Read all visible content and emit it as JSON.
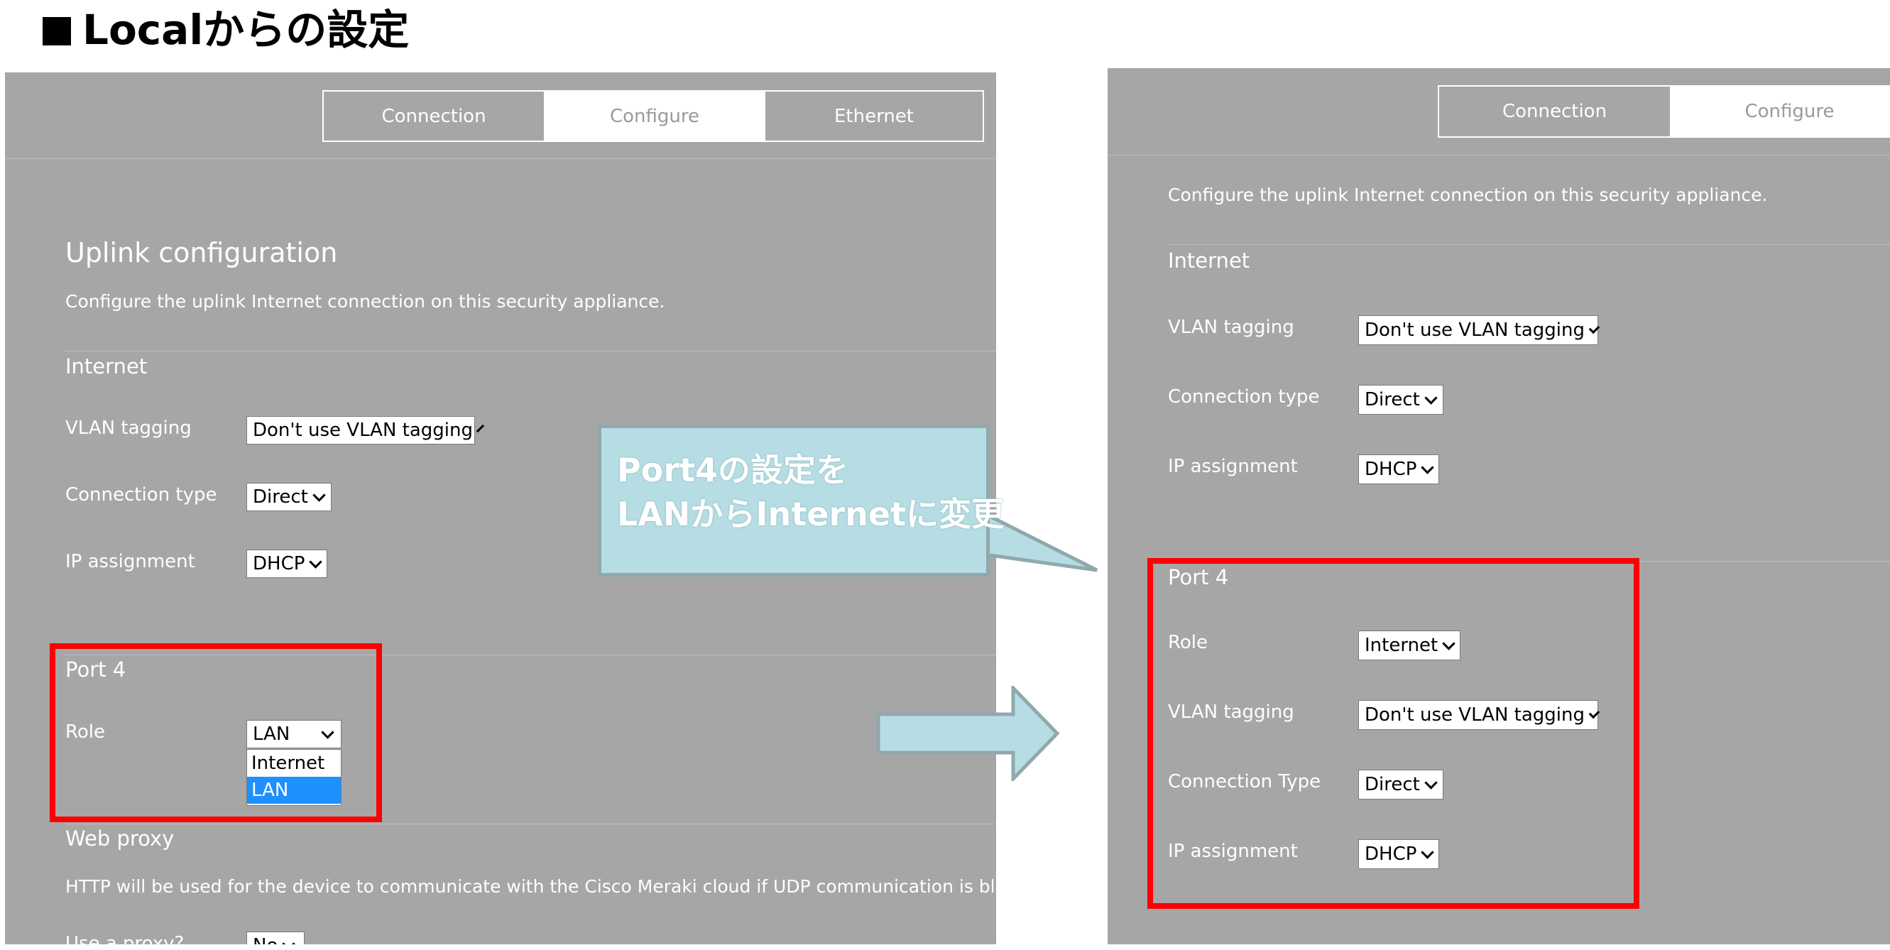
{
  "heading": "Localからの設定",
  "left": {
    "tabs": [
      {
        "label": "Connection",
        "active": false
      },
      {
        "label": "Configure",
        "active": true
      },
      {
        "label": "Ethernet",
        "active": false
      }
    ],
    "uplink_title": "Uplink configuration",
    "uplink_desc": "Configure the uplink Internet connection on this security appliance.",
    "internet_title": "Internet",
    "vlan_label": "VLAN tagging",
    "vlan_value": "Don't use VLAN tagging",
    "conn_label": "Connection type",
    "conn_value": "Direct",
    "ip_label": "IP assignment",
    "ip_value": "DHCP",
    "port_title": "Port 4",
    "role_label": "Role",
    "role_value": "LAN",
    "role_options": [
      "Internet",
      "LAN"
    ],
    "proxy_title": "Web proxy",
    "proxy_desc": "HTTP will be used for the device to communicate with the Cisco Meraki cloud if UDP communication is blocked",
    "proxy_label": "Use a proxy?",
    "proxy_value": "No"
  },
  "callout": {
    "line1": "Port4の設定を",
    "line2": "LANからInternetに変更"
  },
  "right": {
    "tabs": [
      {
        "label": "Connection",
        "active": false
      },
      {
        "label": "Configure",
        "active": true
      }
    ],
    "desc": "Configure the uplink Internet connection on this security appliance.",
    "internet_title": "Internet",
    "vlan_label": "VLAN tagging",
    "vlan_value": "Don't use VLAN tagging",
    "conn_label": "Connection type",
    "conn_value": "Direct",
    "ip_label": "IP assignment",
    "ip_value": "DHCP",
    "port_title": "Port 4",
    "role_label": "Role",
    "role_value": "Internet",
    "port_vlan_label": "VLAN tagging",
    "port_vlan_value": "Don't use VLAN tagging",
    "port_conn_label": "Connection Type",
    "port_conn_value": "Direct",
    "port_ip_label": "IP assignment",
    "port_ip_value": "DHCP"
  },
  "colors": {
    "panel": "#a6a6a6",
    "highlight_box": "#ff0000",
    "callout_fill": "#b6dde3",
    "arrow_fill": "#b6dde3",
    "dropdown_selected": "#1e90ff"
  }
}
